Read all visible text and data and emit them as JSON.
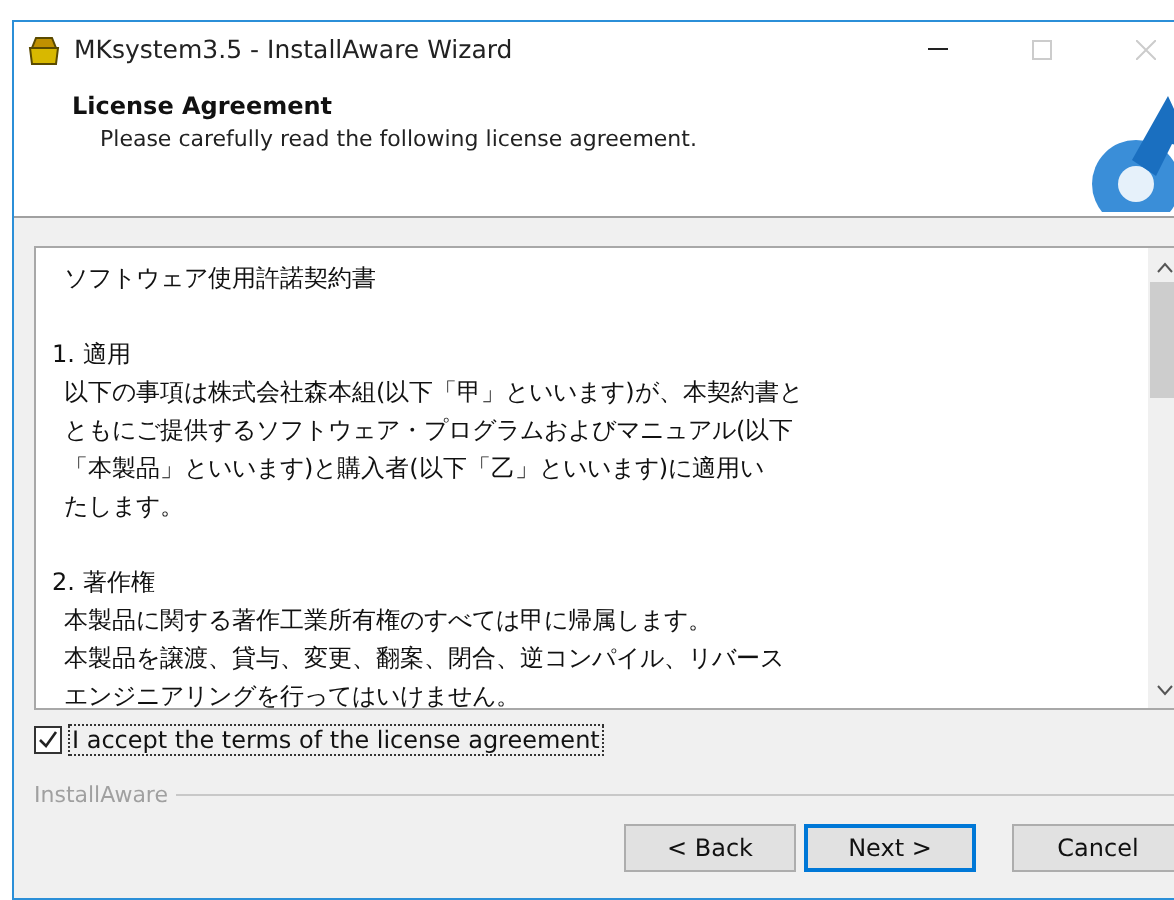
{
  "window": {
    "title": "MKsystem3.5 - InstallAware Wizard"
  },
  "header": {
    "title": "License Agreement",
    "subtitle": "Please carefully read the following license agreement."
  },
  "license": {
    "title": "ソフトウェア使用許諾契約書",
    "sections": [
      {
        "heading": "1. 適用",
        "lines": [
          "以下の事項は株式会社森本組(以下「甲」といいます)が、本契約書と",
          "ともにご提供するソフトウェア・プログラムおよびマニュアル(以下",
          "「本製品」といいます)と購入者(以下「乙」といいます)に適用い",
          "たします。"
        ]
      },
      {
        "heading": "2. 著作権",
        "lines": [
          "本製品に関する著作工業所有権のすべては甲に帰属します。",
          "本製品を譲渡、貸与、変更、翻案、閉合、逆コンパイル、リバース",
          "エンジニアリングを行ってはいけません。"
        ]
      }
    ]
  },
  "accept": {
    "label": "I accept the terms of the license agreement",
    "checked": true
  },
  "brand": "InstallAware",
  "buttons": [
    {
      "label": "< Back",
      "default": false
    },
    {
      "label": "Next >",
      "default": true
    },
    {
      "label": "Cancel",
      "default": false
    }
  ]
}
